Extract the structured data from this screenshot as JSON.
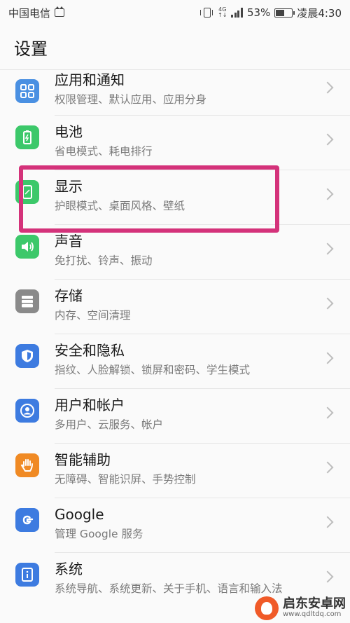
{
  "statusbar": {
    "carrier": "中国电信",
    "network": "4G",
    "battery_pct": "53%",
    "battery_level": 0.53,
    "time": "凌晨4:30"
  },
  "header": {
    "title": "设置"
  },
  "items": [
    {
      "title": "应用和通知",
      "subtitle": "权限管理、默认应用、应用分身",
      "icon": "apps-grid-icon",
      "color": "#4a90e2"
    },
    {
      "title": "电池",
      "subtitle": "省电模式、耗电排行",
      "icon": "battery-icon",
      "color": "#3cc86a"
    },
    {
      "title": "显示",
      "subtitle": "护眼模式、桌面风格、壁纸",
      "icon": "display-icon",
      "color": "#3cc86a"
    },
    {
      "title": "声音",
      "subtitle": "免打扰、铃声、振动",
      "icon": "speaker-icon",
      "color": "#3cc86a"
    },
    {
      "title": "存储",
      "subtitle": "内存、空间清理",
      "icon": "storage-icon",
      "color": "#8a8a8a"
    },
    {
      "title": "安全和隐私",
      "subtitle": "指纹、人脸解锁、锁屏和密码、学生模式",
      "icon": "shield-icon",
      "color": "#3d7be0"
    },
    {
      "title": "用户和帐户",
      "subtitle": "多用户、云服务、帐户",
      "icon": "user-icon",
      "color": "#3d7be0"
    },
    {
      "title": "智能辅助",
      "subtitle": "无障碍、智能识屏、手势控制",
      "icon": "hand-icon",
      "color": "#f08a24"
    },
    {
      "title": "Google",
      "subtitle": "管理 Google 服务",
      "icon": "google-icon",
      "color": "#3d7be0"
    },
    {
      "title": "系统",
      "subtitle": "系统导航、系统更新、关于手机、语言和输入法",
      "icon": "info-icon",
      "color": "#3d7be0"
    }
  ],
  "watermark": {
    "brand": "启东安卓网",
    "url": "www.qdltdq.com"
  }
}
